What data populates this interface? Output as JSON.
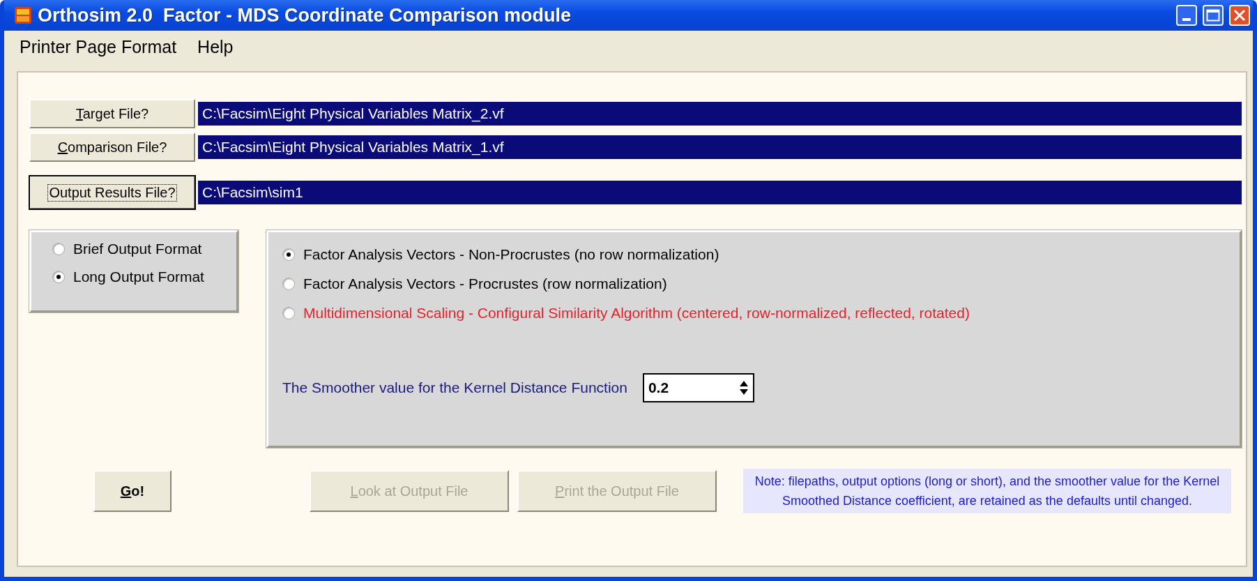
{
  "window": {
    "title": "Orthosim 2.0  Factor - MDS Coordinate Comparison module"
  },
  "menu": [
    "Printer Page Format",
    "Help"
  ],
  "files": [
    {
      "button": {
        "key": "T",
        "rest": "arget File?",
        "focused": false
      },
      "path": "C:\\Facsim\\Eight Physical Variables Matrix_2.vf"
    },
    {
      "button": {
        "key": "C",
        "rest": "omparison File?",
        "focused": false
      },
      "path": "C:\\Facsim\\Eight Physical Variables Matrix_1.vf"
    },
    {
      "button": {
        "rest": "Output Results File?",
        "focused": true
      },
      "path": "C:\\Facsim\\sim1"
    }
  ],
  "output_format": [
    {
      "label": "Brief Output Format",
      "selected": false
    },
    {
      "label": "Long Output Format",
      "selected": true
    }
  ],
  "methods": [
    {
      "label": "Factor Analysis Vectors - Non-Procrustes (no row normalization)",
      "selected": true,
      "color": "#000000"
    },
    {
      "label": "Factor Analysis Vectors - Procrustes (row normalization)",
      "selected": false,
      "color": "#000000"
    },
    {
      "label": "Multidimensional Scaling - Configural Similarity Algorithm (centered, row-normalized, reflected, rotated)",
      "selected": false,
      "color": "#e8202a"
    }
  ],
  "smoother": {
    "label": "The Smoother value for the Kernel Distance Function",
    "value": "0.2"
  },
  "actions": [
    {
      "key": "G",
      "rest": "o!",
      "disabled": false
    },
    {
      "key": "L",
      "rest": "ook at Output File",
      "disabled": true
    },
    {
      "key": "P",
      "rest": "rint the Output File",
      "disabled": true
    }
  ],
  "note": "Note: filepaths, output options (long or short), and the smoother value for the Kernel Smoothed Distance coefficient, are retained as the defaults until changed."
}
